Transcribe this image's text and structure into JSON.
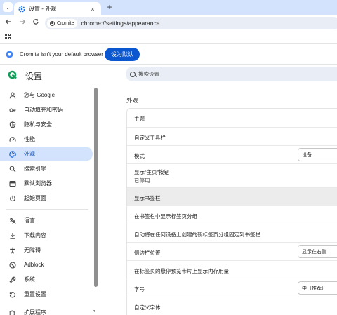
{
  "browser": {
    "tab_title": "设置 - 外观",
    "tab_close": "×",
    "new_tab": "+",
    "omnibox_chip": "Cromite",
    "url": "chrome://settings/appearance"
  },
  "infobar": {
    "message": "Cromite isn't your default browser",
    "button": "设为默认"
  },
  "settings": {
    "title": "设置",
    "search_placeholder": "搜索设置",
    "sidebar": [
      {
        "label": "您与 Google",
        "icon": "person-icon"
      },
      {
        "label": "自动填充和密码",
        "icon": "key-icon"
      },
      {
        "label": "隐私与安全",
        "icon": "shield-icon"
      },
      {
        "label": "性能",
        "icon": "speedometer-icon"
      },
      {
        "label": "外观",
        "icon": "palette-icon",
        "active": true
      },
      {
        "label": "搜索引擎",
        "icon": "search-icon"
      },
      {
        "label": "默认浏览器",
        "icon": "browser-icon"
      },
      {
        "label": "起始页面",
        "icon": "power-icon"
      },
      {
        "label": "语言",
        "icon": "translate-icon"
      },
      {
        "label": "下载内容",
        "icon": "download-icon"
      },
      {
        "label": "无障碍",
        "icon": "accessibility-icon"
      },
      {
        "label": "Adblock",
        "icon": "block-icon"
      },
      {
        "label": "系统",
        "icon": "wrench-icon"
      },
      {
        "label": "重置设置",
        "icon": "reset-icon"
      },
      {
        "label": "扩展程序",
        "icon": "extension-icon"
      }
    ],
    "section_title": "外观",
    "rows": [
      {
        "label": "主题"
      },
      {
        "label": "自定义工具栏"
      },
      {
        "label": "模式",
        "value": "设备"
      },
      {
        "label": "显示“主页”按钮",
        "sublabel": "已停用"
      },
      {
        "label": "显示书签栏"
      },
      {
        "label": "在书签栏中显示标签页分组"
      },
      {
        "label": "自动将在任何设备上创建的新标签页分组固定到书签栏"
      },
      {
        "label": "侧边栏位置",
        "value": "显示在右侧"
      },
      {
        "label": "在标签页的悬停预览卡片上显示内存用量"
      },
      {
        "label": "字号",
        "value": "中（推荐）"
      },
      {
        "label": "自定义字体"
      }
    ]
  }
}
